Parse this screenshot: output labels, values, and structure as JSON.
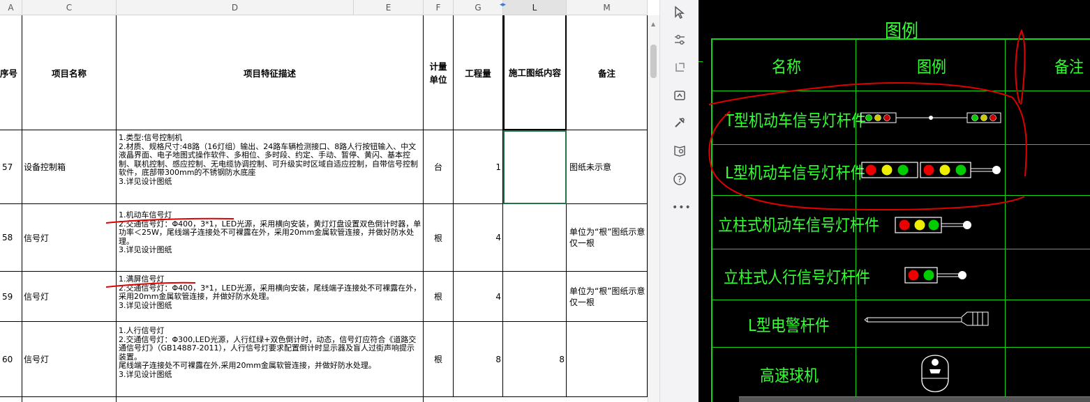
{
  "columns": [
    "A",
    "C",
    "D",
    "E",
    "F",
    "G",
    "L",
    "M"
  ],
  "header": {
    "seq": "序号",
    "name": "项目名称",
    "desc": "项目特征描述",
    "unit": "计量单位",
    "qty": "工程量",
    "drawing": "施工图纸内容",
    "remark": "备注"
  },
  "rows": [
    {
      "seq": "57",
      "name": "设备控制箱",
      "desc": "1.类型:信号控制机\n2.材质、规格尺寸:48路（16灯组）输出、24路车辆检测接口、8路人行按钮输入、中文液晶界面、电子地图式操作软件、多相位、多时段、约定、手动、暂停、黄闪、基本控制、联机控制、感应控制、无电缆协调控制、可升级实时区域自适应控制，自带信号控制软件，底部带300mm的不锈钢防水底座\n3.详见设计图纸",
      "unit": "台",
      "qty": "1",
      "drawing": "",
      "remark": "图纸未示意"
    },
    {
      "seq": "58",
      "name": "信号灯",
      "desc": "1.机动车信号灯\n2.交通信号灯：Φ400，3*1，LED光源，采用横向安装，黄灯灯盘设置双色倒计时器，单功率＜25W，尾线端子连接处不可裸露在外，采用20mm金属软管连接，并做好防水处理。\n3.详见设计图纸",
      "unit": "根",
      "qty": "4",
      "drawing": "",
      "remark": "单位为“根”图纸示意仅一根"
    },
    {
      "seq": "59",
      "name": "信号灯",
      "desc": "1.满屏信号灯\n2.交通信号灯：Φ400，3*1，LED光源，采用横向安装，尾线端子连接处不可裸露在外，采用20mm金属软管连接，并做好防水处理。\n3.详见设计图纸",
      "unit": "根",
      "qty": "4",
      "drawing": "",
      "remark": "单位为“根”图纸示意仅一根"
    },
    {
      "seq": "60",
      "name": "信号灯",
      "desc": "1.人行信号灯\n2.交通信号灯：Φ300,LED光源，人行红绿+双色倒计时，动态，信号灯应符合《道路交通信号灯》（GB14887-2011），人行信号灯要求配置倒计时显示器及盲人过街声响提示装置。\n尾线端子连接处不可裸露在外,采用20mm金属软管连接，并做好防水处理。\n3.详见设计图纸",
      "unit": "根",
      "qty": "8",
      "drawing": "8",
      "remark": ""
    }
  ],
  "sidebar_tools": [
    "cursor-icon",
    "adjust-icon",
    "transform-icon",
    "compare-icon",
    "tools-icon",
    "book-search-icon",
    "help-icon",
    "more-icon"
  ],
  "cad": {
    "title": "图例",
    "col_name": "名称",
    "col_symbol": "图例",
    "col_remark": "备注",
    "items": [
      "T型机动车信号灯杆件",
      "L型机动车信号灯杆件",
      "立柱式机动车信号灯杆件",
      "立柱式人行信号灯杆件",
      "L型电警杆件",
      "高速球机"
    ],
    "colors": {
      "line": "#15d615",
      "text": "#33ff33",
      "annotation": "#e00000"
    }
  }
}
